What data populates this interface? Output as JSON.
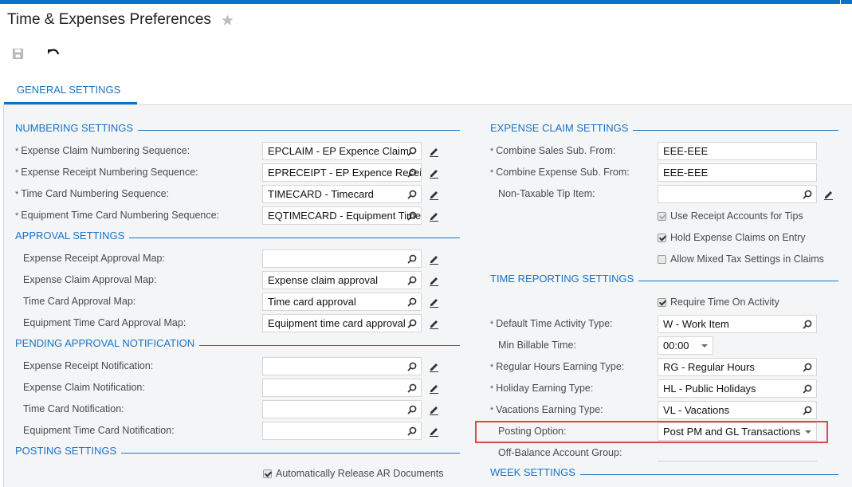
{
  "header": {
    "title": "Time & Expenses Preferences",
    "favorite_icon": "star-icon"
  },
  "toolbar": {
    "save_icon": "save-icon",
    "undo_icon": "undo-icon"
  },
  "tabs": [
    {
      "label": "GENERAL SETTINGS",
      "active": true
    }
  ],
  "colors": {
    "accent": "#0a74c9",
    "highlight": "#e04848",
    "background": "#f4f5f7"
  },
  "left": {
    "numbering": {
      "title": "NUMBERING SETTINGS",
      "rows": [
        {
          "label": "Expense Claim Numbering Sequence:",
          "required": true,
          "value": "EPCLAIM - EP Expence Claim"
        },
        {
          "label": "Expense Receipt Numbering Sequence:",
          "required": true,
          "value": "EPRECEIPT - EP Expence Receipt"
        },
        {
          "label": "Time Card Numbering Sequence:",
          "required": true,
          "value": "TIMECARD - Timecard"
        },
        {
          "label": "Equipment Time Card Numbering Sequence:",
          "required": true,
          "value": "EQTIMECARD - Equipment Timecard"
        }
      ]
    },
    "approval": {
      "title": "APPROVAL SETTINGS",
      "rows": [
        {
          "label": "Expense Receipt Approval Map:",
          "value": ""
        },
        {
          "label": "Expense Claim Approval Map:",
          "value": "Expense claim approval"
        },
        {
          "label": "Time Card Approval Map:",
          "value": "Time card approval"
        },
        {
          "label": "Equipment Time Card Approval Map:",
          "value": "Equipment time card approval"
        }
      ]
    },
    "pending": {
      "title": "PENDING APPROVAL NOTIFICATION",
      "rows": [
        {
          "label": "Expense Receipt Notification:",
          "value": ""
        },
        {
          "label": "Expense Claim Notification:",
          "value": ""
        },
        {
          "label": "Time Card Notification:",
          "value": ""
        },
        {
          "label": "Equipment Time Card Notification:",
          "value": ""
        }
      ]
    },
    "posting": {
      "title": "POSTING SETTINGS",
      "auto_release_label": "Automatically Release AR Documents",
      "auto_release_checked": true
    }
  },
  "right": {
    "expense": {
      "title": "EXPENSE CLAIM SETTINGS",
      "combine_sales_label": "Combine Sales Sub. From:",
      "combine_sales_value": "EEE-EEE",
      "combine_expense_label": "Combine Expense Sub. From:",
      "combine_expense_value": "EEE-EEE",
      "tip_item_label": "Non-Taxable Tip Item:",
      "tip_item_value": "",
      "checks": [
        {
          "label": "Use Receipt Accounts for Tips",
          "checked": true,
          "disabled": true
        },
        {
          "label": "Hold Expense Claims on Entry",
          "checked": true,
          "disabled": false
        },
        {
          "label": "Allow Mixed Tax Settings in Claims",
          "checked": false,
          "disabled": false
        }
      ]
    },
    "time": {
      "title": "TIME REPORTING SETTINGS",
      "require_time_label": "Require Time On Activity",
      "require_time_checked": true,
      "default_activity_label": "Default Time Activity Type:",
      "default_activity_value": "W - Work Item",
      "min_billable_label": "Min Billable Time:",
      "min_billable_value": "00:00",
      "regular_label": "Regular Hours Earning Type:",
      "regular_value": "RG - Regular Hours",
      "holiday_label": "Holiday Earning Type:",
      "holiday_value": "HL - Public Holidays",
      "vacation_label": "Vacations Earning Type:",
      "vacation_value": "VL - Vacations",
      "posting_label": "Posting Option:",
      "posting_value": "Post PM and GL Transactions",
      "offbalance_label": "Off-Balance Account Group:",
      "offbalance_value": ""
    },
    "week": {
      "title": "WEEK SETTINGS"
    }
  },
  "required_marker": "*"
}
